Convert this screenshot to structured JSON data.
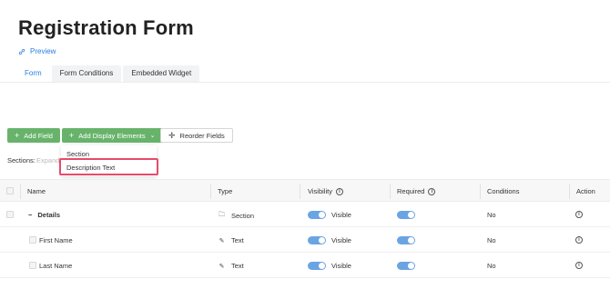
{
  "page": {
    "title": "Registration Form",
    "preview_label": "Preview"
  },
  "tabs": [
    {
      "label": "Form",
      "active": true
    },
    {
      "label": "Form Conditions",
      "active": false
    },
    {
      "label": "Embedded Widget",
      "active": false
    }
  ],
  "toolbar": {
    "add_field_label": "Add Field",
    "add_display_label": "Add Display Elements",
    "reorder_label": "Reorder Fields"
  },
  "dropdown": {
    "items": [
      "Section",
      "Description Text"
    ],
    "highlighted": "Description Text"
  },
  "sections": {
    "label": "Sections:",
    "value": "Expand"
  },
  "table": {
    "headers": {
      "name": "Name",
      "type": "Type",
      "visibility": "Visibility",
      "required": "Required",
      "conditions": "Conditions",
      "action": "Action"
    },
    "rows": [
      {
        "name": "Details",
        "prefix": "−",
        "type": "Section",
        "type_icon": "folder-icon",
        "visibility": "Visible",
        "visible_on": true,
        "required_on": true,
        "conditions": "No"
      },
      {
        "name": "First Name",
        "prefix": "",
        "type": "Text",
        "type_icon": "pencil-icon",
        "visibility": "Visible",
        "visible_on": true,
        "required_on": true,
        "conditions": "No"
      },
      {
        "name": "Last Name",
        "prefix": "",
        "type": "Text",
        "type_icon": "pencil-icon",
        "visibility": "Visible",
        "visible_on": true,
        "required_on": true,
        "conditions": "No"
      }
    ]
  },
  "colors": {
    "accent": "#2a7de1",
    "green_button": "#68b36b",
    "highlight_border": "#e84a6b",
    "toggle_on": "#5b9be0"
  }
}
